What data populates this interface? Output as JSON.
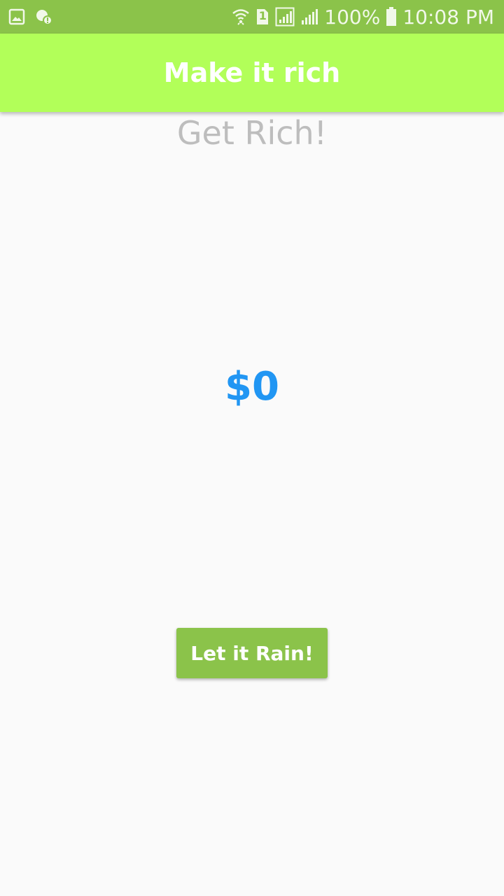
{
  "status_bar": {
    "battery": "100%",
    "time": "10:08 PM",
    "sim_badge": "1",
    "icons": [
      "gallery-icon",
      "notification-alert-icon",
      "wifi-icon",
      "sim-icon",
      "signal-1-icon",
      "signal-2-icon",
      "battery-icon"
    ]
  },
  "app_bar": {
    "title": "Make it rich"
  },
  "main": {
    "headline": "Get Rich!",
    "amount": "$0",
    "button_label": "Let it Rain!"
  },
  "colors": {
    "status_bar": "#8bc34a",
    "app_bar": "#b2ff59",
    "amount": "#2196f3",
    "button": "#8bc34a",
    "headline": "#bdbdbd"
  }
}
